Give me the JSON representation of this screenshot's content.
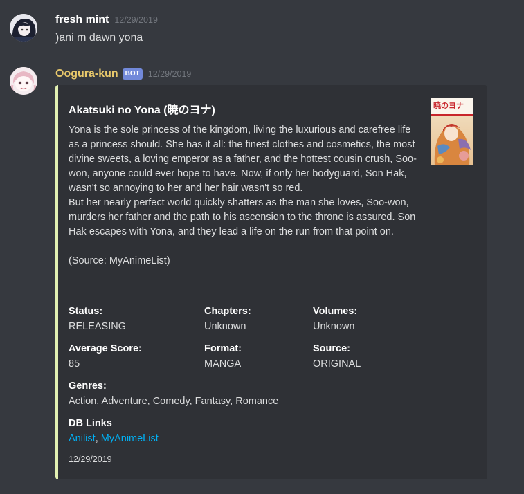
{
  "messages": [
    {
      "username": "fresh mint",
      "timestamp": "12/29/2019",
      "content": ")ani m dawn yona"
    },
    {
      "username": "Oogura-kun",
      "bot_tag": "BOT",
      "timestamp": "12/29/2019"
    }
  ],
  "embed": {
    "title": "Akatsuki no Yona (暁のヨナ)",
    "description": "Yona is the sole princess of the kingdom, living the luxurious and carefree life as a princess should. She has it all: the finest clothes and cosmetics, the most divine sweets, a loving emperor as a father, and the hottest cousin crush, Soo-won, anyone could ever hope to have. Now, if only her bodyguard, Son Hak, wasn't so annoying to her and her hair wasn't so red.\nBut her nearly perfect world quickly shatters as the man she loves, Soo-won, murders her father and the path to his ascension to the throne is assured. Son Hak escapes with Yona, and they lead a life on the run from that point on.\n\n(Source: MyAnimeList)",
    "thumbnail_title": "暁のヨナ",
    "accent_color": "#e2f0b2",
    "fields": {
      "status": {
        "name": "Status:",
        "value": "RELEASING"
      },
      "chapters": {
        "name": "Chapters:",
        "value": "Unknown"
      },
      "volumes": {
        "name": "Volumes:",
        "value": "Unknown"
      },
      "average_score": {
        "name": "Average Score:",
        "value": "85"
      },
      "format": {
        "name": "Format:",
        "value": "MANGA"
      },
      "source": {
        "name": "Source:",
        "value": "ORIGINAL"
      },
      "genres": {
        "name": "Genres:",
        "value": "Action, Adventure, Comedy, Fantasy, Romance"
      }
    },
    "db_links": {
      "name": "DB Links",
      "anilist": "Anilist",
      "separator": ", ",
      "myanimelist": "MyAnimeList"
    },
    "footer": "12/29/2019"
  }
}
